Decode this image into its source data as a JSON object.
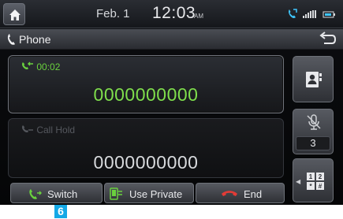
{
  "status_bar": {
    "date": "Feb.  1",
    "time": "12:03",
    "ampm": "AM",
    "icons": [
      "home-icon",
      "phone-connected-icon",
      "signal-icon",
      "battery-icon"
    ]
  },
  "title_bar": {
    "title": "Phone",
    "back_icon": "back-arrow-icon"
  },
  "active_call": {
    "duration": "00:02",
    "number": "0000000000",
    "color": "#7fde4c"
  },
  "held_call": {
    "status": "Call Hold",
    "number": "0000000000"
  },
  "buttons": {
    "switch_label": "Switch",
    "private_label": "Use Private",
    "end_label": "End"
  },
  "side_panel": {
    "mute_count": "3"
  },
  "callout": {
    "label": "6",
    "color": "#14a8e6"
  }
}
